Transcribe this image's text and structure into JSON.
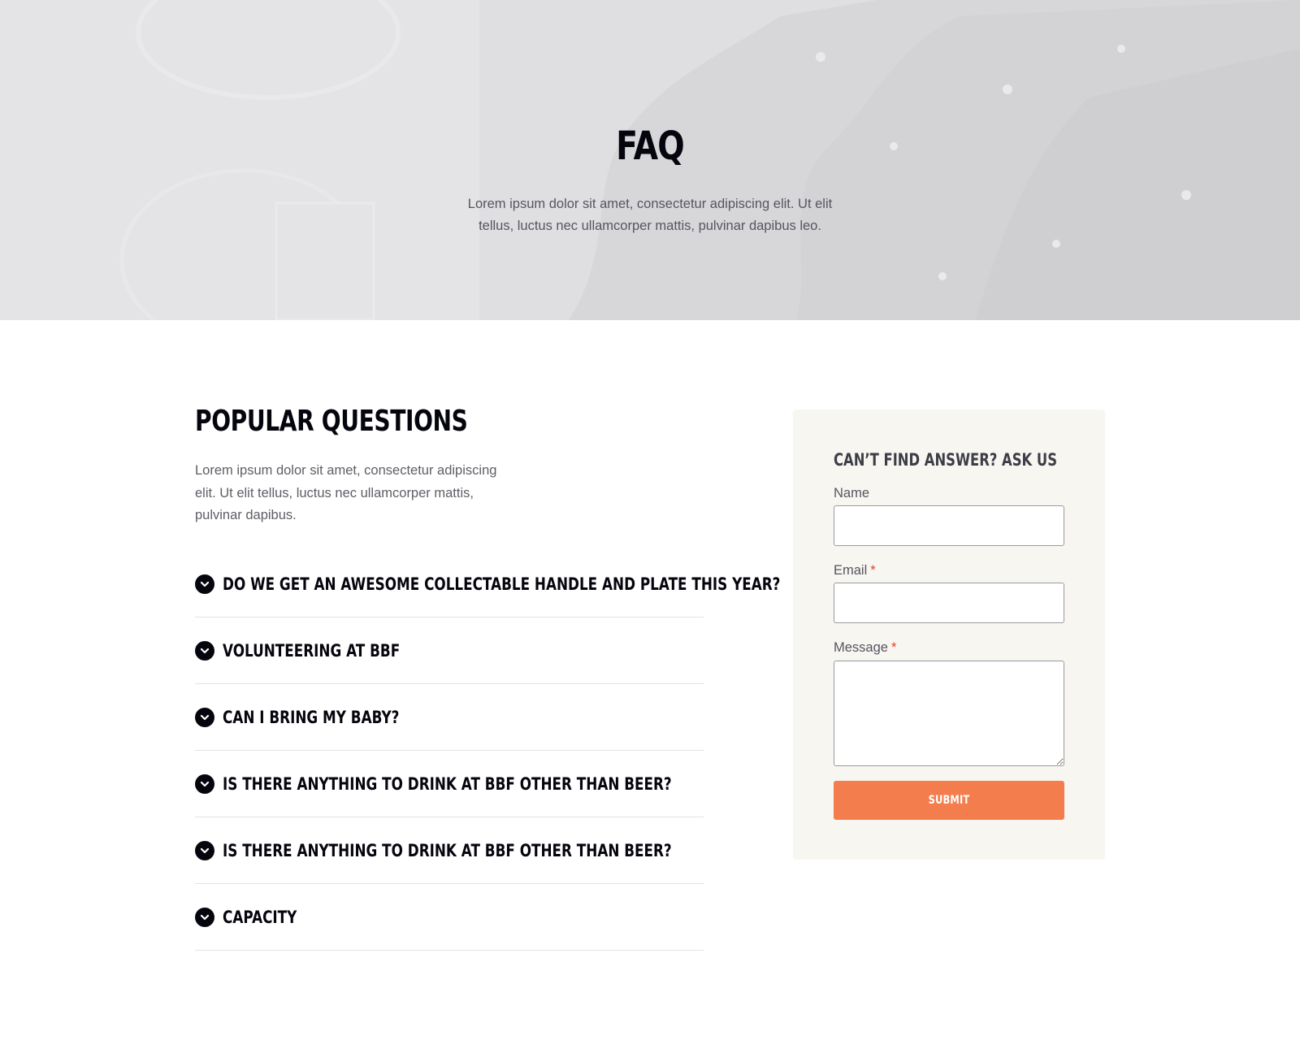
{
  "hero": {
    "title": "FAQ",
    "subtitle": "Lorem ipsum dolor sit amet, consectetur adipiscing elit. Ut elit tellus, luctus nec ullamcorper mattis, pulvinar dapibus leo."
  },
  "faq_section": {
    "title": "Popular Questions",
    "description": "Lorem ipsum dolor sit amet, consectetur adipiscing elit. Ut elit tellus, luctus nec ullamcorper mattis, pulvinar dapibus.",
    "items": [
      {
        "question": "Do we get an awesome collectable handle and plate this year?",
        "icon": "chevron-down-icon"
      },
      {
        "question": "Volunteering at BBF",
        "icon": "chevron-down-icon"
      },
      {
        "question": "Can I bring my baby?",
        "icon": "chevron-down-icon"
      },
      {
        "question": "Is there anything to drink at BBF other than beer?",
        "icon": "chevron-down-icon"
      },
      {
        "question": "Is there anything to drink at BBF other than beer?",
        "icon": "chevron-down-icon"
      },
      {
        "question": "Capacity",
        "icon": "chevron-down-icon"
      }
    ]
  },
  "contact_form": {
    "title": "Can’t find answer? Ask us",
    "name_label": "Name",
    "name_value": "",
    "email_label": "Email",
    "email_value": "",
    "message_label": "Message",
    "message_value": "",
    "required_marker": "*",
    "submit_label": "Submit"
  },
  "colors": {
    "heading": "#05050e",
    "body_text": "#55555f",
    "form_background": "#f8f6f1",
    "submit_button": "#f47d4d",
    "required_marker": "#e2412b"
  }
}
